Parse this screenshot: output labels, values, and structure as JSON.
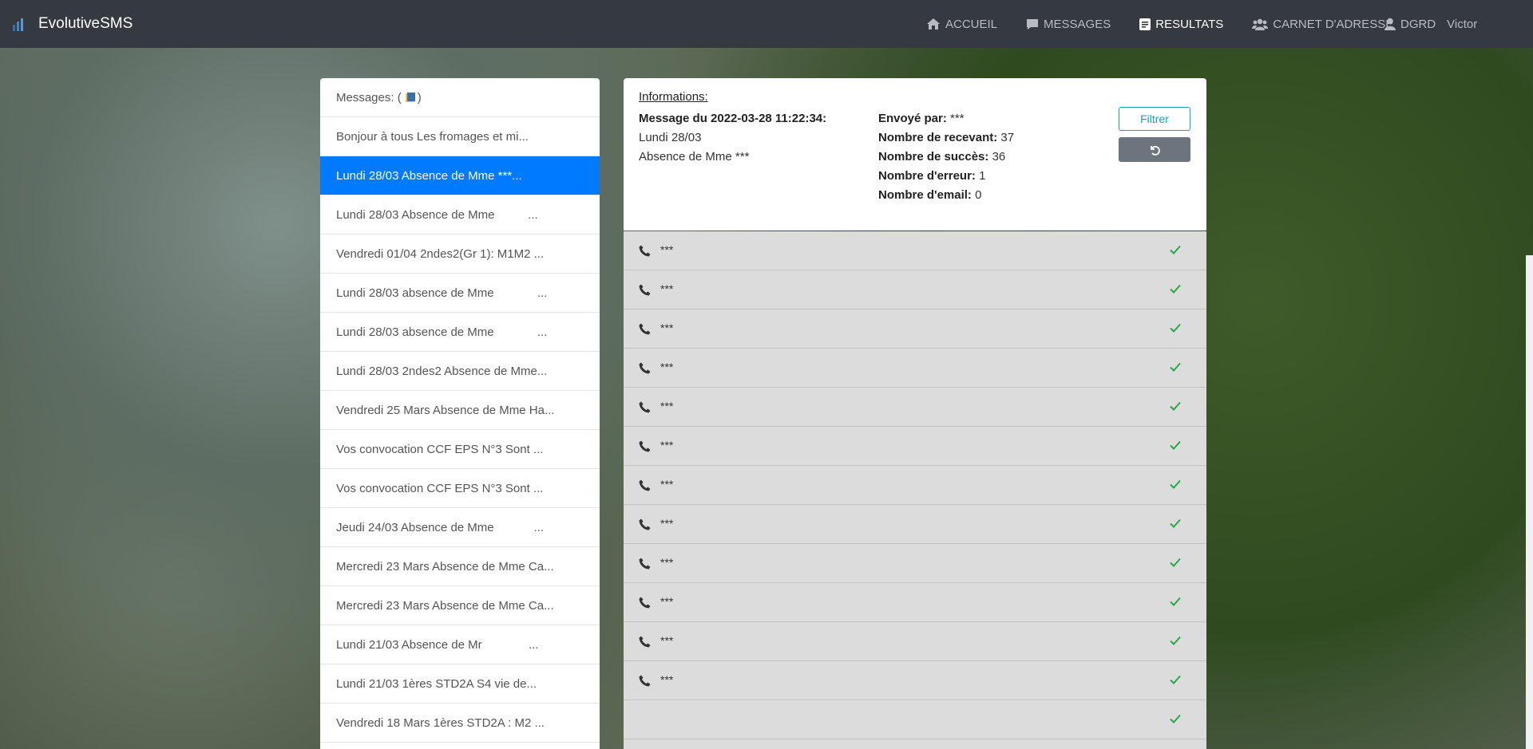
{
  "navbar": {
    "brand": "EvolutiveSMS",
    "items": [
      {
        "label": "ACCUEIL",
        "icon": "home-icon",
        "active": false
      },
      {
        "label": "MESSAGES",
        "icon": "comment-icon",
        "active": false
      },
      {
        "label": "RESULTATS",
        "icon": "list-icon",
        "active": true
      },
      {
        "label": "CARNET D'ADRESSE",
        "icon": "users-icon",
        "active": false
      }
    ],
    "user": {
      "role": "DGRD",
      "name": "Victor"
    }
  },
  "messages": {
    "header_prefix": "Messages: (",
    "header_suffix": ")",
    "items": [
      "Bonjour à tous Les fromages et mi...",
      "Lundi 28/03 Absence de Mme ***...",
      "Lundi 28/03 Absence de Mme          ...",
      "Vendredi 01/04 2ndes2(Gr 1): M1M2 ...",
      "Lundi 28/03 absence de Mme             ...",
      "Lundi 28/03 absence de Mme             ...",
      "Lundi 28/03 2ndes2 Absence de Mme...",
      "Vendredi 25 Mars Absence de Mme Ha...",
      "Vos convocation CCF EPS N°3 Sont ...",
      "Vos convocation CCF EPS N°3 Sont ...",
      "Jeudi 24/03 Absence de Mme            ...",
      "Mercredi 23 Mars Absence de Mme Ca...",
      "Mercredi 23 Mars Absence de Mme Ca...",
      "Lundi 21/03 Absence de Mr              ...",
      "Lundi 21/03 1ères STD2A S4 vie de...",
      "Vendredi 18 Mars 1ères STD2A : M2 ..."
    ],
    "active_index": 1
  },
  "info": {
    "title": "Informations:",
    "message_label": "Message du 2022-03-28 11:22:34:",
    "message_line1": "Lundi 28/03",
    "message_line2": "Absence de Mme ***",
    "sent_by_label": "Envoyé par:",
    "sent_by_value": "***",
    "recipients_label": "Nombre de recevant:",
    "recipients_value": "37",
    "success_label": "Nombre de succès:",
    "success_value": "36",
    "errors_label": "Nombre d'erreur:",
    "errors_value": "1",
    "emails_label": "Nombre d'email:",
    "emails_value": "0",
    "filter_button": "Filtrer"
  },
  "results": [
    {
      "number": "***"
    },
    {
      "number": "***"
    },
    {
      "number": "***"
    },
    {
      "number": "***"
    },
    {
      "number": "***"
    },
    {
      "number": "***"
    },
    {
      "number": "***"
    },
    {
      "number": "***"
    },
    {
      "number": "***"
    },
    {
      "number": "***"
    },
    {
      "number": "***"
    },
    {
      "number": "***"
    },
    {
      "number": ""
    }
  ],
  "colors": {
    "navbar": "#343a40",
    "active_item": "#007bff",
    "success_check": "#28a745",
    "filter_outline": "#17a2b8",
    "reset_button": "#6c757d"
  }
}
